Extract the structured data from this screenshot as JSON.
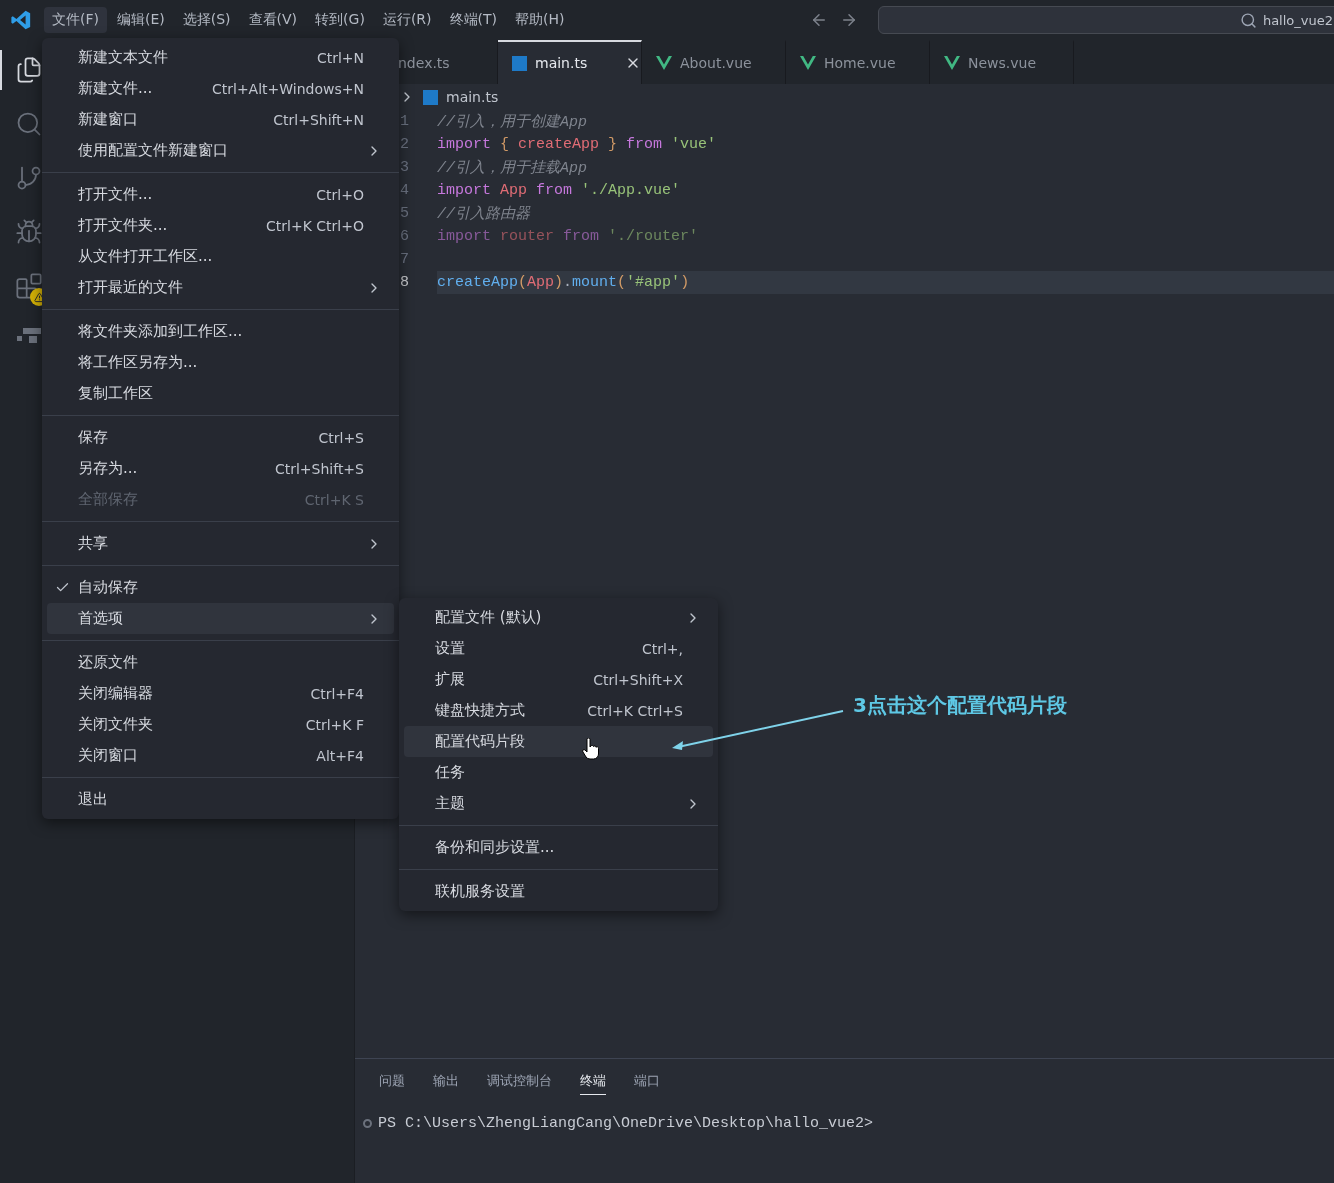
{
  "title_bar": {
    "menus": [
      {
        "label": "文件(F)",
        "selected": true
      },
      {
        "label": "编辑(E)",
        "selected": false
      },
      {
        "label": "选择(S)",
        "selected": false
      },
      {
        "label": "查看(V)",
        "selected": false
      },
      {
        "label": "转到(G)",
        "selected": false
      },
      {
        "label": "运行(R)",
        "selected": false
      },
      {
        "label": "终端(T)",
        "selected": false
      },
      {
        "label": "帮助(H)",
        "selected": false
      }
    ],
    "search": {
      "value": "hallo_vue2"
    }
  },
  "activity_bar": [
    {
      "kind": "files",
      "selected": true
    },
    {
      "kind": "search",
      "selected": false
    },
    {
      "kind": "git",
      "selected": false
    },
    {
      "kind": "debug",
      "selected": false
    },
    {
      "kind": "extensions",
      "selected": false,
      "warning": true
    },
    {
      "kind": "remote",
      "selected": false
    }
  ],
  "tabs": [
    {
      "label": "ndex.ts",
      "kind": "clipped",
      "selected": false
    },
    {
      "label": "main.ts",
      "kind": "ts",
      "selected": true
    },
    {
      "label": "About.vue",
      "kind": "vue",
      "selected": false
    },
    {
      "label": "Home.vue",
      "kind": "vue",
      "selected": false
    },
    {
      "label": "News.vue",
      "kind": "vue",
      "selected": false
    }
  ],
  "breadcrumb": {
    "file": "main.ts"
  },
  "code": [
    {
      "number": "1",
      "current": false,
      "tokens": [
        {
          "kind": "comment",
          "text": "//引入，用于创建App"
        }
      ]
    },
    {
      "number": "2",
      "current": false,
      "tokens": [
        {
          "kind": "keyword",
          "text": "import"
        },
        {
          "kind": "brace",
          "text": " {"
        },
        {
          "kind": "var",
          "text": " createApp"
        },
        {
          "kind": "brace",
          "text": " }"
        },
        {
          "kind": "keyword",
          "text": " from"
        },
        {
          "kind": "string",
          "text": " 'vue'"
        }
      ]
    },
    {
      "number": "3",
      "current": false,
      "tokens": [
        {
          "kind": "comment",
          "text": "//引入，用于挂载App"
        }
      ]
    },
    {
      "number": "4",
      "current": false,
      "tokens": [
        {
          "kind": "keyword",
          "text": "import"
        },
        {
          "kind": "var",
          "text": " App"
        },
        {
          "kind": "keyword",
          "text": " from"
        },
        {
          "kind": "string",
          "text": " './App.vue'"
        }
      ]
    },
    {
      "number": "5",
      "current": false,
      "tokens": [
        {
          "kind": "comment",
          "text": "//引入路由器"
        }
      ]
    },
    {
      "number": "6",
      "current": false,
      "faded": true,
      "tokens": [
        {
          "kind": "keyword",
          "text": "import"
        },
        {
          "kind": "var",
          "text": " router"
        },
        {
          "kind": "keyword",
          "text": " from"
        },
        {
          "kind": "string",
          "text": " './router'"
        }
      ]
    },
    {
      "number": "7",
      "current": false
    },
    {
      "number": "8",
      "current": true,
      "tokens": [
        {
          "kind": "fn",
          "text": "createApp"
        },
        {
          "kind": "brace",
          "text": "("
        },
        {
          "kind": "var",
          "text": "App"
        },
        {
          "kind": "brace",
          "text": ")"
        },
        {
          "kind": "plain",
          "text": "."
        },
        {
          "kind": "fn",
          "text": "mount"
        },
        {
          "kind": "brace",
          "text": "("
        },
        {
          "kind": "string",
          "text": "'#app'"
        },
        {
          "kind": "brace",
          "text": ")"
        }
      ]
    }
  ],
  "file_menu": [
    [
      {
        "label": "新建文本文件",
        "shortcut": "Ctrl+N",
        "kind": "command",
        "checked": false,
        "disabled": false,
        "selected": false
      },
      {
        "label": "新建文件...",
        "shortcut": "Ctrl+Alt+Windows+N",
        "kind": "command",
        "checked": false,
        "disabled": false,
        "selected": false
      },
      {
        "label": "新建窗口",
        "shortcut": "Ctrl+Shift+N",
        "kind": "command",
        "checked": false,
        "disabled": false,
        "selected": false
      },
      {
        "label": "使用配置文件新建窗口",
        "kind": "submenu",
        "checked": false,
        "disabled": false,
        "selected": false
      }
    ],
    [
      {
        "label": "打开文件...",
        "shortcut": "Ctrl+O",
        "kind": "command",
        "checked": false,
        "disabled": false,
        "selected": false
      },
      {
        "label": "打开文件夹...",
        "shortcut": "Ctrl+K Ctrl+O",
        "kind": "command",
        "checked": false,
        "disabled": false,
        "selected": false
      },
      {
        "label": "从文件打开工作区...",
        "kind": "command",
        "checked": false,
        "disabled": false,
        "selected": false
      },
      {
        "label": "打开最近的文件",
        "kind": "submenu",
        "checked": false,
        "disabled": false,
        "selected": false
      }
    ],
    [
      {
        "label": "将文件夹添加到工作区...",
        "kind": "command",
        "checked": false,
        "disabled": false,
        "selected": false
      },
      {
        "label": "将工作区另存为...",
        "kind": "command",
        "checked": false,
        "disabled": false,
        "selected": false
      },
      {
        "label": "复制工作区",
        "kind": "command",
        "checked": false,
        "disabled": false,
        "selected": false
      }
    ],
    [
      {
        "label": "保存",
        "shortcut": "Ctrl+S",
        "kind": "command",
        "checked": false,
        "disabled": false,
        "selected": false
      },
      {
        "label": "另存为...",
        "shortcut": "Ctrl+Shift+S",
        "kind": "command",
        "checked": false,
        "disabled": false,
        "selected": false
      },
      {
        "label": "全部保存",
        "shortcut": "Ctrl+K S",
        "kind": "command",
        "checked": false,
        "disabled": true,
        "selected": false
      }
    ],
    [
      {
        "label": "共享",
        "kind": "submenu",
        "checked": false,
        "disabled": false,
        "selected": false
      }
    ],
    [
      {
        "label": "自动保存",
        "kind": "command",
        "checked": true,
        "disabled": false,
        "selected": false
      },
      {
        "label": "首选项",
        "kind": "submenu",
        "checked": false,
        "disabled": false,
        "selected": true
      }
    ],
    [
      {
        "label": "还原文件",
        "kind": "command",
        "checked": false,
        "disabled": false,
        "selected": false
      },
      {
        "label": "关闭编辑器",
        "shortcut": "Ctrl+F4",
        "kind": "command",
        "checked": false,
        "disabled": false,
        "selected": false
      },
      {
        "label": "关闭文件夹",
        "shortcut": "Ctrl+K F",
        "kind": "command",
        "checked": false,
        "disabled": false,
        "selected": false
      },
      {
        "label": "关闭窗口",
        "shortcut": "Alt+F4",
        "kind": "command",
        "checked": false,
        "disabled": false,
        "selected": false
      }
    ],
    [
      {
        "label": "退出",
        "kind": "command",
        "checked": false,
        "disabled": false,
        "selected": false
      }
    ]
  ],
  "preferences_menu": [
    [
      {
        "label": "配置文件 (默认)",
        "kind": "submenu",
        "selected": false
      },
      {
        "label": "设置",
        "shortcut": "Ctrl+,",
        "kind": "command",
        "selected": false
      },
      {
        "label": "扩展",
        "shortcut": "Ctrl+Shift+X",
        "kind": "command",
        "selected": false
      },
      {
        "label": "键盘快捷方式",
        "shortcut": "Ctrl+K Ctrl+S",
        "kind": "command",
        "selected": false
      },
      {
        "label": "配置代码片段",
        "kind": "command",
        "selected": true
      },
      {
        "label": "任务",
        "kind": "command",
        "selected": false
      },
      {
        "label": "主题",
        "kind": "submenu",
        "selected": false
      }
    ],
    [
      {
        "label": "备份和同步设置...",
        "kind": "command",
        "selected": false
      }
    ],
    [
      {
        "label": "联机服务设置",
        "kind": "command",
        "selected": false
      }
    ]
  ],
  "annotation": {
    "text": "3点击这个配置代码片段"
  },
  "panel": {
    "tabs": [
      {
        "label": "问题",
        "selected": false
      },
      {
        "label": "输出",
        "selected": false
      },
      {
        "label": "调试控制台",
        "selected": false
      },
      {
        "label": "终端",
        "selected": true
      },
      {
        "label": "端口",
        "selected": false
      }
    ],
    "terminal_line": "PS C:\\Users\\ZhengLiangCang\\OneDrive\\Desktop\\hallo_vue2>"
  }
}
